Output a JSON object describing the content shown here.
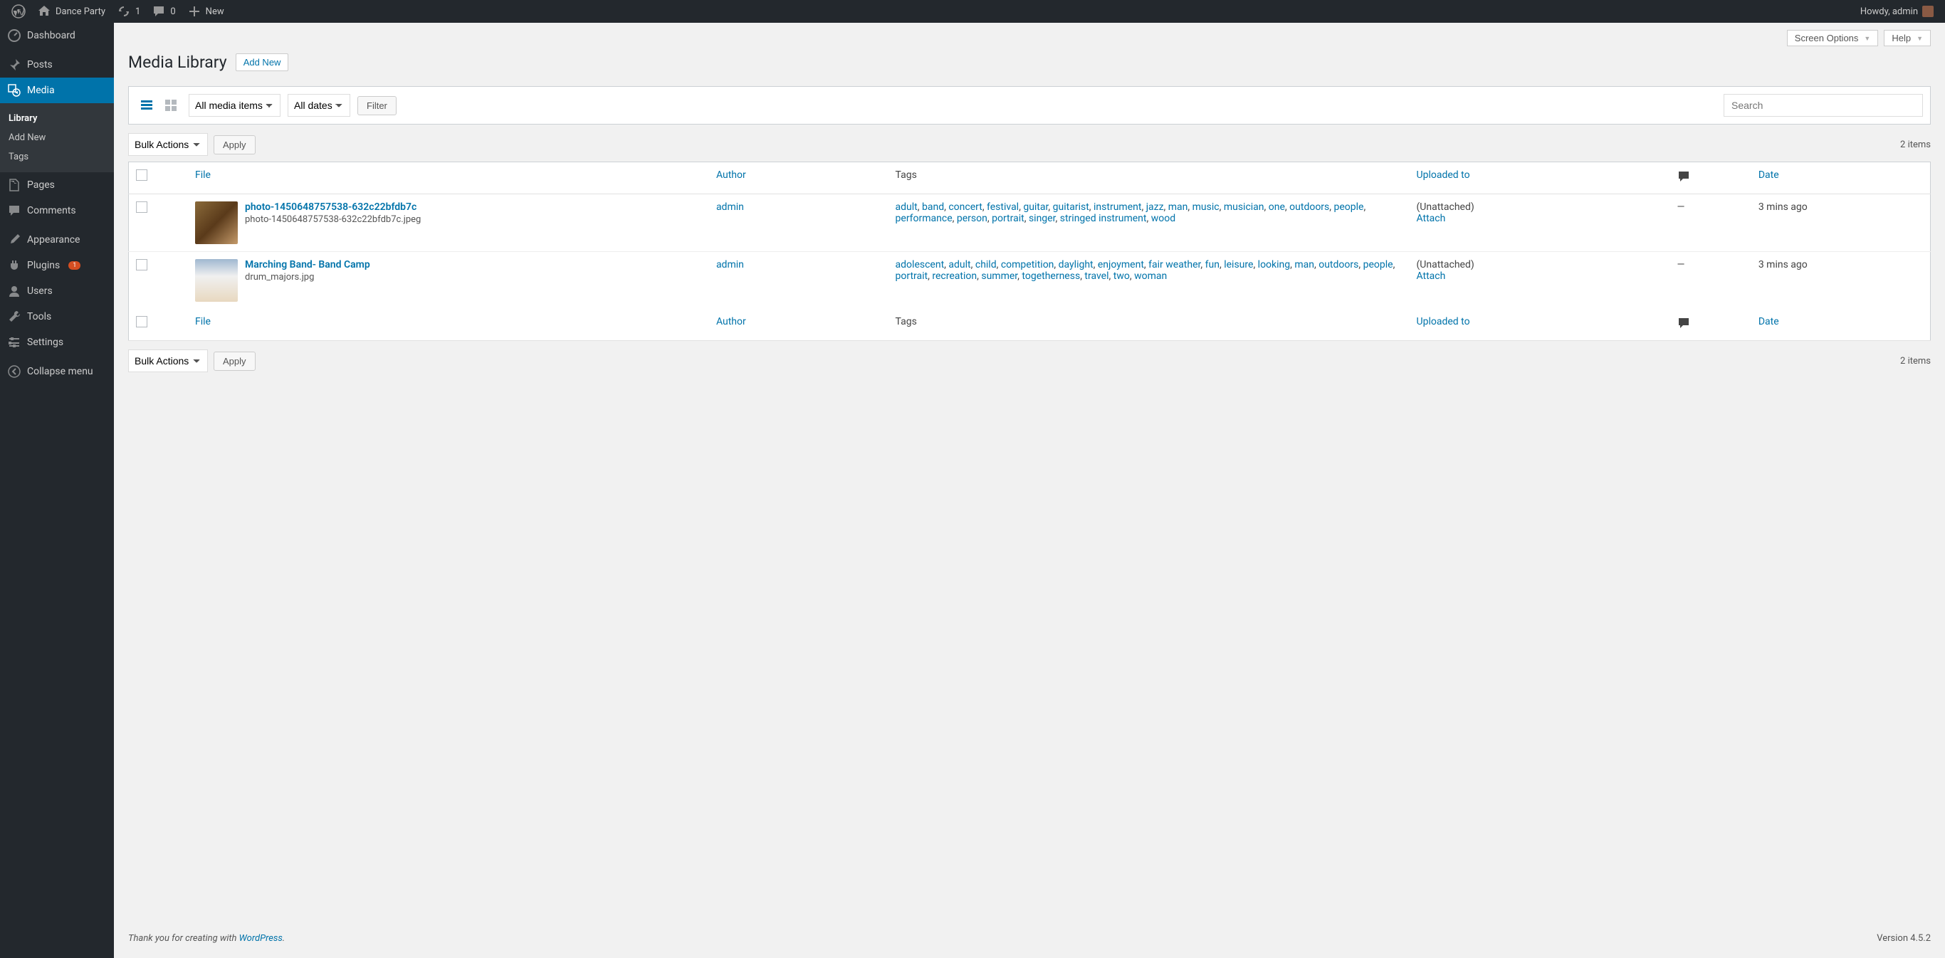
{
  "admin_bar": {
    "site_name": "Dance Party",
    "updates": "1",
    "comments": "0",
    "new": "New",
    "howdy": "Howdy, admin"
  },
  "sidebar": {
    "dashboard": "Dashboard",
    "posts": "Posts",
    "media": "Media",
    "media_sub": {
      "library": "Library",
      "add_new": "Add New",
      "tags": "Tags"
    },
    "pages": "Pages",
    "comments": "Comments",
    "appearance": "Appearance",
    "plugins": "Plugins",
    "plugins_badge": "1",
    "users": "Users",
    "tools": "Tools",
    "settings": "Settings",
    "collapse": "Collapse menu"
  },
  "header": {
    "screen_options": "Screen Options",
    "help": "Help"
  },
  "page": {
    "title": "Media Library",
    "add_new": "Add New"
  },
  "filters": {
    "media_types": "All media items",
    "dates": "All dates",
    "filter_btn": "Filter",
    "search_placeholder": "Search"
  },
  "bulk": {
    "bulk_actions": "Bulk Actions",
    "apply": "Apply",
    "count": "2 items"
  },
  "columns": {
    "file": "File",
    "author": "Author",
    "tags": "Tags",
    "uploaded": "Uploaded to",
    "date": "Date"
  },
  "rows": [
    {
      "title": "photo-1450648757538-632c22bfdb7c",
      "filename": "photo-1450648757538-632c22bfdb7c.jpeg",
      "author": "admin",
      "tags": [
        "adult",
        "band",
        "concert",
        "festival",
        "guitar",
        "guitarist",
        "instrument",
        "jazz",
        "man",
        "music",
        "musician",
        "one",
        "outdoors",
        "people",
        "performance",
        "person",
        "portrait",
        "singer",
        "stringed instrument",
        "wood"
      ],
      "uploaded": "(Unattached)",
      "attach": "Attach",
      "comments": "—",
      "date": "3 mins ago",
      "thumb_class": "thumb-guitar"
    },
    {
      "title": "Marching Band- Band Camp",
      "filename": "drum_majors.jpg",
      "author": "admin",
      "tags": [
        "adolescent",
        "adult",
        "child",
        "competition",
        "daylight",
        "enjoyment",
        "fair weather",
        "fun",
        "leisure",
        "looking",
        "man",
        "outdoors",
        "people",
        "portrait",
        "recreation",
        "summer",
        "togetherness",
        "travel",
        "two",
        "woman"
      ],
      "uploaded": "(Unattached)",
      "attach": "Attach",
      "comments": "—",
      "date": "3 mins ago",
      "thumb_class": "thumb-band"
    }
  ],
  "footer": {
    "thankyou_prefix": "Thank you for creating with ",
    "wordpress": "WordPress",
    "version": "Version 4.5.2"
  }
}
